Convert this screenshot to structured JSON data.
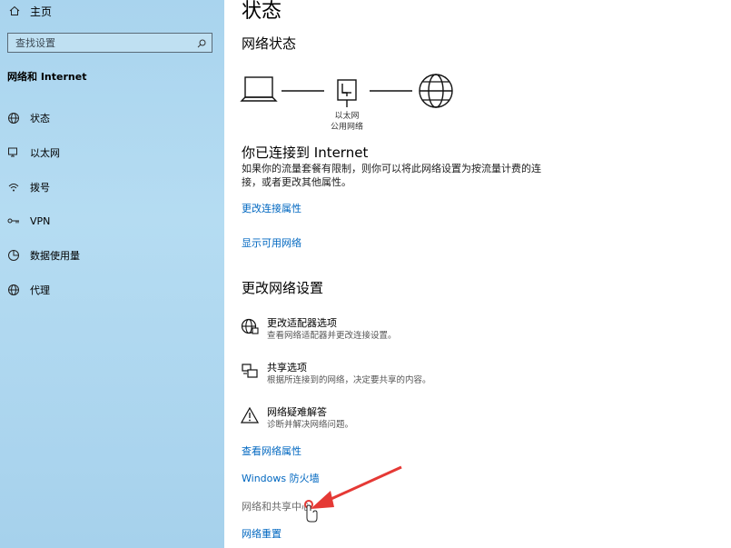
{
  "sidebar": {
    "home_label": "主页",
    "search_placeholder": "查找设置",
    "section_title": "网络和 Internet",
    "items": [
      {
        "label": "状态",
        "icon": "status-icon"
      },
      {
        "label": "以太网",
        "icon": "ethernet-icon"
      },
      {
        "label": "拨号",
        "icon": "dialup-icon"
      },
      {
        "label": "VPN",
        "icon": "vpn-icon"
      },
      {
        "label": "数据使用量",
        "icon": "data-usage-icon"
      },
      {
        "label": "代理",
        "icon": "proxy-icon"
      }
    ]
  },
  "main": {
    "title": "状态",
    "network_status_heading": "网络状态",
    "diagram": {
      "adapter_name": "以太网",
      "network_type": "公用网络"
    },
    "connected_heading": "你已连接到 Internet",
    "connected_desc": "如果你的流量套餐有限制，则你可以将此网络设置为按流量计费的连接，或者更改其他属性。",
    "links_top": [
      "更改连接属性",
      "显示可用网络"
    ],
    "change_settings_heading": "更改网络设置",
    "options": [
      {
        "title": "更改适配器选项",
        "subtitle": "查看网络适配器并更改连接设置。",
        "icon": "adapter-globe-icon"
      },
      {
        "title": "共享选项",
        "subtitle": "根据所连接到的网络，决定要共享的内容。",
        "icon": "sharing-icon"
      },
      {
        "title": "网络疑难解答",
        "subtitle": "诊断并解决网络问题。",
        "icon": "warning-icon"
      }
    ],
    "links_bottom": [
      "查看网络属性",
      "Windows 防火墙"
    ],
    "sharing_center": "网络和共享中心",
    "reset_link": "网络重置"
  },
  "colors": {
    "link": "#0067c0",
    "sidebar_bg": "#a9d4ee",
    "arrow": "#e53935"
  }
}
